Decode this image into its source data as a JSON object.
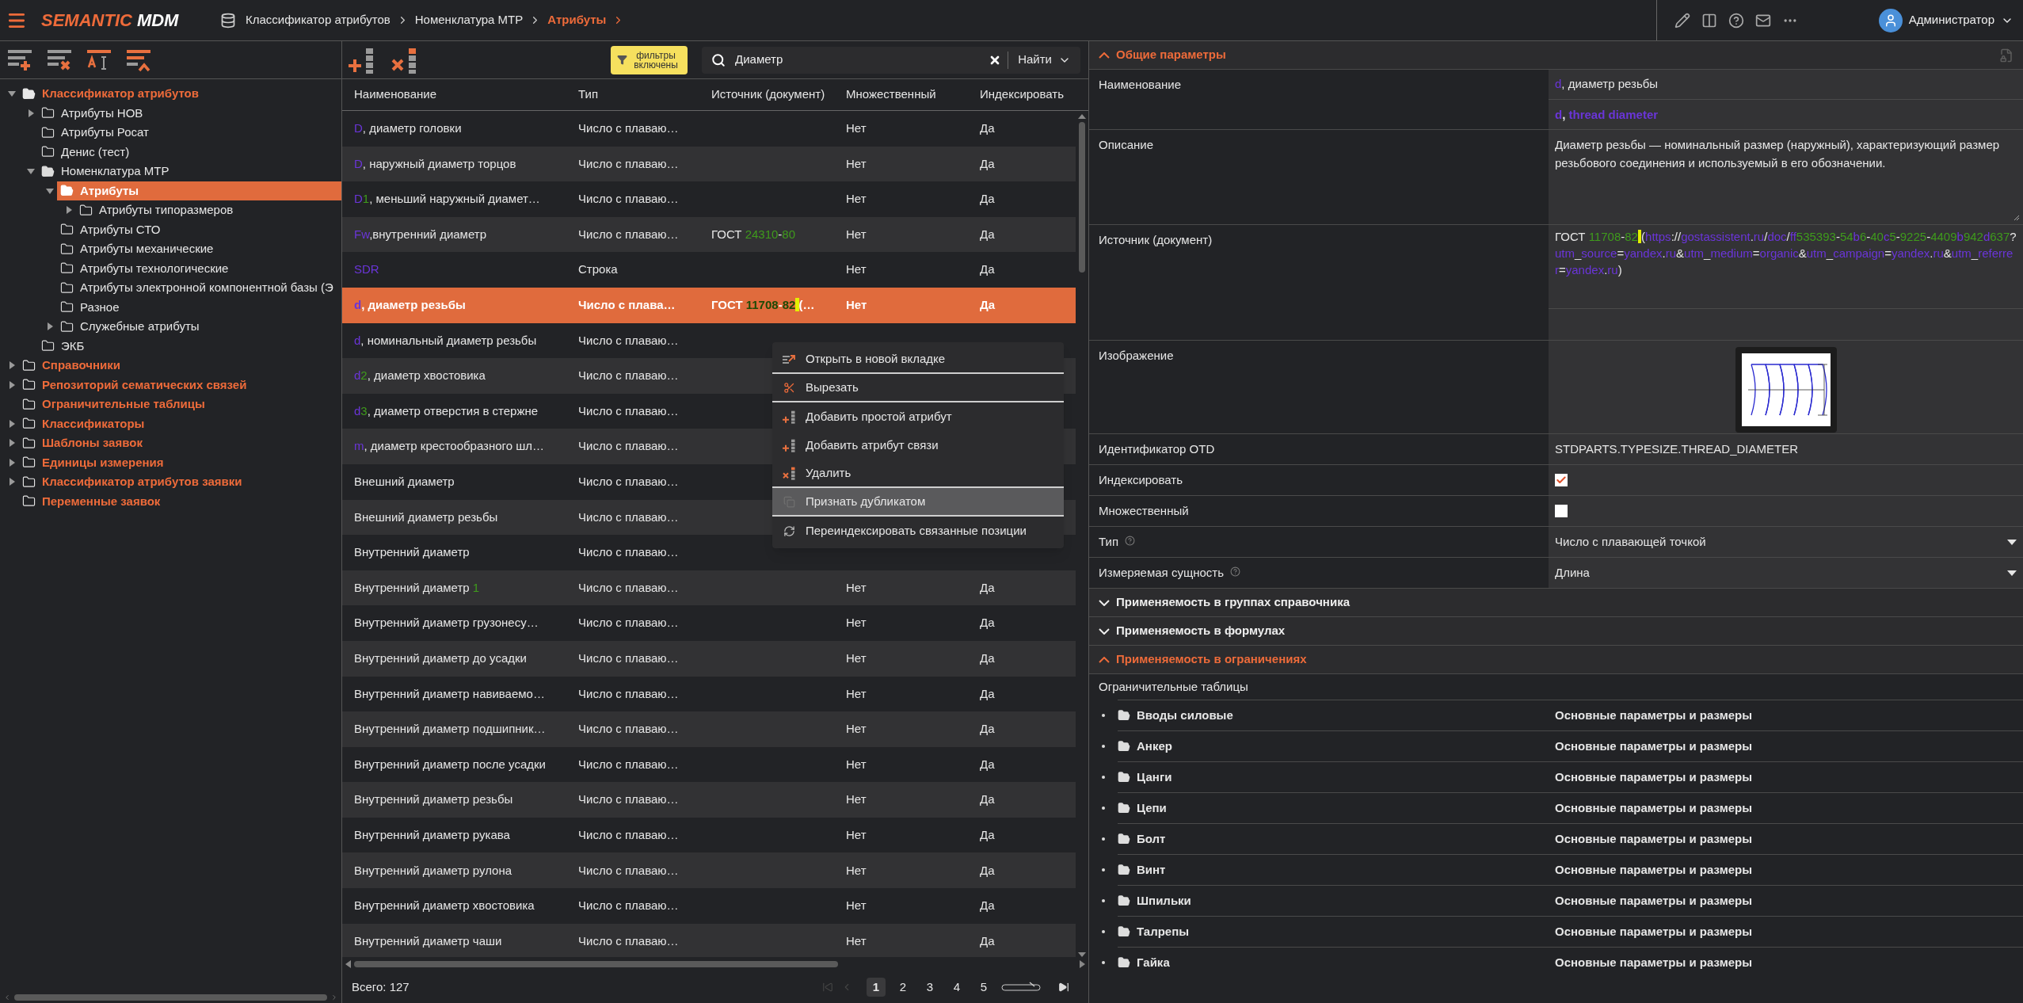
{
  "header": {
    "logo_bold": "SEMANTIC",
    "logo_rest": "MDM",
    "breadcrumbs": [
      {
        "label": "Классификатор атрибутов",
        "current": false
      },
      {
        "label": "Номенклатура МТР",
        "current": false
      },
      {
        "label": "Атрибуты",
        "current": true
      }
    ],
    "user": "Администратор"
  },
  "tree": [
    {
      "label": "Классификатор атрибутов",
      "expandable": true,
      "expanded": true,
      "selected": false,
      "children": [
        {
          "label": "Атрибуты НОВ",
          "expandable": true,
          "expanded": false,
          "selected": false
        },
        {
          "label": "Атрибуты Росат",
          "expandable": false,
          "expanded": false,
          "selected": false
        },
        {
          "label": "Денис (тест)",
          "expandable": false,
          "expanded": false,
          "selected": false
        },
        {
          "label": "Номенклатура МТР",
          "expandable": true,
          "expanded": true,
          "selected": false,
          "children": [
            {
              "label": "Атрибуты",
              "expandable": true,
              "expanded": true,
              "selected": true,
              "children": [
                {
                  "label": "Атрибуты типоразмеров",
                  "expandable": true,
                  "expanded": false,
                  "selected": false
                }
              ]
            },
            {
              "label": "Атрибуты СТО",
              "expandable": false,
              "expanded": false,
              "selected": false
            },
            {
              "label": "Атрибуты механические",
              "expandable": false,
              "expanded": false,
              "selected": false
            },
            {
              "label": "Атрибуты технологические",
              "expandable": false,
              "expanded": false,
              "selected": false
            },
            {
              "label": "Атрибуты электронной компонентной базы (Э",
              "expandable": false,
              "expanded": false,
              "selected": false
            },
            {
              "label": "Разное",
              "expandable": false,
              "expanded": false,
              "selected": false
            },
            {
              "label": "Служебные атрибуты",
              "expandable": true,
              "expanded": false,
              "selected": false
            }
          ]
        },
        {
          "label": "ЭКБ",
          "expandable": false,
          "expanded": false,
          "selected": false
        }
      ]
    },
    {
      "label": "Справочники",
      "expandable": true,
      "expanded": false,
      "selected": false
    },
    {
      "label": "Репозиторий сематических связей",
      "expandable": true,
      "expanded": false,
      "selected": false
    },
    {
      "label": "Ограничительные таблицы",
      "expandable": false,
      "expanded": false,
      "selected": false
    },
    {
      "label": "Классификаторы",
      "expandable": true,
      "expanded": false,
      "selected": false
    },
    {
      "label": "Шаблоны заявок",
      "expandable": true,
      "expanded": false,
      "selected": false
    },
    {
      "label": "Единицы измерения",
      "expandable": true,
      "expanded": false,
      "selected": false
    },
    {
      "label": "Классификатор атрибутов заявки",
      "expandable": true,
      "expanded": false,
      "selected": false
    },
    {
      "label": "Переменные заявок",
      "expandable": false,
      "expanded": false,
      "selected": false
    }
  ],
  "filter_badge": "фильтры включены",
  "search": {
    "value": "Диаметр",
    "button": "Найти"
  },
  "table": {
    "columns": [
      "Наименование",
      "Тип",
      "Источник (документ)",
      "Множественный",
      "Индексировать"
    ],
    "rows": [
      {
        "name": "D, диаметр головки",
        "type": "Число с плаваю…",
        "source": "",
        "multiple": "Нет",
        "index": "Да",
        "selected": false
      },
      {
        "name": "D, наружный диаметр торцов",
        "type": "Число с плаваю…",
        "source": "",
        "multiple": "Нет",
        "index": "Да",
        "selected": false
      },
      {
        "name": "D1, меньший наружный диамет…",
        "type": "Число с плаваю…",
        "source": "",
        "multiple": "Нет",
        "index": "Да",
        "selected": false
      },
      {
        "name": "Fw,внутренний диаметр",
        "type": "Число с плаваю…",
        "source": "ГОСТ 24310-80",
        "multiple": "Нет",
        "index": "Да",
        "selected": false
      },
      {
        "name": "SDR",
        "type": "Строка",
        "source": "",
        "multiple": "Нет",
        "index": "Да",
        "selected": false
      },
      {
        "name": "d, диаметр резьбы",
        "type": "Число с плава…",
        "source": "ГОСТ 11708-82 (…",
        "multiple": "Нет",
        "index": "Да",
        "selected": true
      },
      {
        "name": "d, номинальный диаметр резьбы",
        "type": "Число с плаваю…",
        "source": "",
        "selected": false
      },
      {
        "name": "d2, диаметр хвостовика",
        "type": "Число с плаваю…",
        "source": "",
        "selected": false
      },
      {
        "name": "d3, диаметр отверстия в стержне",
        "type": "Число с плаваю…",
        "source": "",
        "selected": false
      },
      {
        "name": "m, диаметр крестообразного шл…",
        "type": "Число с плаваю…",
        "source": "",
        "selected": false
      },
      {
        "name": "Внешний диаметр",
        "type": "Число с плаваю…",
        "source": "",
        "selected": false
      },
      {
        "name": "Внешний диаметр резьбы",
        "type": "Число с плаваю…",
        "source": "",
        "selected": false
      },
      {
        "name": "Внутренний диаметр",
        "type": "Число с плаваю…",
        "source": "",
        "selected": false
      },
      {
        "name": "Внутренний диаметр 1",
        "type": "Число с плаваю…",
        "source": "",
        "multiple": "Нет",
        "index": "Да",
        "selected": false
      },
      {
        "name": "Внутренний диаметр грузонесу…",
        "type": "Число с плаваю…",
        "source": "",
        "multiple": "Нет",
        "index": "Да",
        "selected": false
      },
      {
        "name": "Внутренний диаметр до усадки",
        "type": "Число с плаваю…",
        "source": "",
        "multiple": "Нет",
        "index": "Да",
        "selected": false
      },
      {
        "name": "Внутренний диаметр навиваемо…",
        "type": "Число с плаваю…",
        "source": "",
        "multiple": "Нет",
        "index": "Да",
        "selected": false
      },
      {
        "name": "Внутренний диаметр подшипник…",
        "type": "Число с плаваю…",
        "source": "",
        "multiple": "Нет",
        "index": "Да",
        "selected": false
      },
      {
        "name": "Внутренний диаметр после усадки",
        "type": "Число с плаваю…",
        "source": "",
        "multiple": "Нет",
        "index": "Да",
        "selected": false
      },
      {
        "name": "Внутренний диаметр резьбы",
        "type": "Число с плаваю…",
        "source": "",
        "multiple": "Нет",
        "index": "Да",
        "selected": false
      },
      {
        "name": "Внутренний диаметр рукава",
        "type": "Число с плаваю…",
        "source": "",
        "multiple": "Нет",
        "index": "Да",
        "selected": false
      },
      {
        "name": "Внутренний диаметр рулона",
        "type": "Число с плаваю…",
        "source": "",
        "multiple": "Нет",
        "index": "Да",
        "selected": false
      },
      {
        "name": "Внутренний диаметр хвостовика",
        "type": "Число с плаваю…",
        "source": "",
        "multiple": "Нет",
        "index": "Да",
        "selected": false
      },
      {
        "name": "Внутренний диаметр чаши",
        "type": "Число с плаваю…",
        "source": "",
        "multiple": "Нет",
        "index": "Да",
        "selected": false
      }
    ]
  },
  "context_menu": {
    "items": [
      {
        "label": "Открыть в новой вкладке",
        "highlighted": false,
        "separator_after": true
      },
      {
        "label": "Вырезать",
        "highlighted": false,
        "separator_after": true
      },
      {
        "label": "Добавить простой атрибут",
        "highlighted": false,
        "separator_after": false
      },
      {
        "label": "Добавить атрибут связи",
        "highlighted": false,
        "separator_after": false
      },
      {
        "label": "Удалить",
        "highlighted": false,
        "separator_after": true
      },
      {
        "label": "Признать дубликатом",
        "highlighted": true,
        "separator_after": true
      },
      {
        "label": "Переиндексировать связанные позиции",
        "highlighted": false,
        "separator_after": false
      }
    ]
  },
  "footer": {
    "total": "Всего: 127",
    "pages": [
      {
        "label": "1",
        "selected": true
      },
      {
        "label": "2",
        "selected": false
      },
      {
        "label": "3",
        "selected": false
      },
      {
        "label": "4",
        "selected": false
      },
      {
        "label": "5",
        "selected": false
      }
    ]
  },
  "details": {
    "sections": [
      {
        "kind": "fields",
        "title": "Общие параметры",
        "expanded": true,
        "fields": [
          {
            "kind": "names",
            "label": "Наименование",
            "values": [
              {
                "text": "d, диаметр резьбы",
                "bold": false
              },
              {
                "text": "d, thread diameter",
                "bold": true
              }
            ]
          },
          {
            "kind": "textarea",
            "label": "Описание",
            "value": "Диаметр резьбы — номинальный размер (наружный), характеризующий размер резьбового соединения и используемый в его обозначении."
          },
          {
            "kind": "source",
            "label": "Источник (документ)",
            "value": "ГОСТ 11708-82 (https://gostassistent.ru/doc/ff535393-54b6-40c5-9225-4409b942d637?utm_source=yandex.ru&utm_medium=organic&utm_campaign=yandex.ru&utm_referrer=yandex.ru)"
          },
          {
            "kind": "image",
            "label": "Изображение"
          },
          {
            "kind": "text",
            "label": "Идентификатор OTD",
            "value": "STDPARTS.TYPESIZE.THREAD_DIAMETER"
          },
          {
            "kind": "checkbox",
            "label": "Индексировать",
            "checked": true
          },
          {
            "kind": "checkbox",
            "label": "Множественный",
            "checked": false
          },
          {
            "kind": "select",
            "label": "Тип",
            "help": true,
            "value": "Число с плавающей точкой"
          },
          {
            "kind": "select",
            "label": "Измеряемая сущность",
            "help": true,
            "value": "Длина"
          }
        ]
      },
      {
        "title": "Применяемость в группах справочника",
        "expanded": false
      },
      {
        "title": "Применяемость в формулах",
        "expanded": false
      },
      {
        "kind": "constraints",
        "title": "Применяемость в ограничениях",
        "expanded": true,
        "subtitle": "Ограничительные таблицы",
        "rows": [
          {
            "name": "Вводы силовые",
            "value": "Основные параметры и размеры"
          },
          {
            "name": "Анкер",
            "value": "Основные параметры и размеры"
          },
          {
            "name": "Цанги",
            "value": "Основные параметры и размеры"
          },
          {
            "name": "Цепи",
            "value": "Основные параметры и размеры"
          },
          {
            "name": "Болт",
            "value": "Основные параметры и размеры"
          },
          {
            "name": "Винт",
            "value": "Основные параметры и размеры"
          },
          {
            "name": "Шпильки",
            "value": "Основные параметры и размеры"
          },
          {
            "name": "Талрепы",
            "value": "Основные параметры и размеры"
          },
          {
            "name": "Гайка",
            "value": "Основные параметры и размеры"
          }
        ]
      }
    ]
  }
}
